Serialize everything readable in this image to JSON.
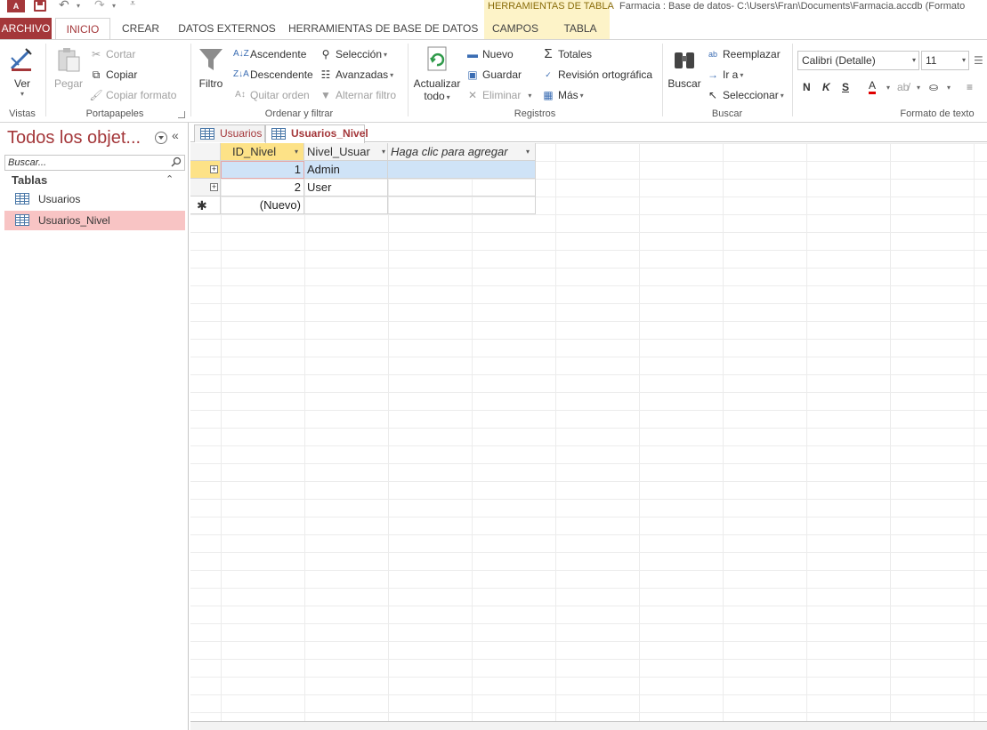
{
  "app": {
    "logo_text": "A",
    "context_group": "HERRAMIENTAS DE TABLA",
    "title": "Farmacia : Base de datos- C:\\Users\\Fran\\Documents\\Farmacia.accdb (Formato"
  },
  "colors": {
    "accent": "#a4373a",
    "context_bg": "#fdf3c8",
    "selected_nav": "#f8c4c4",
    "selected_header": "#fde287",
    "row_highlight": "#cfe3f7"
  },
  "tabs": [
    {
      "label": "ARCHIVO"
    },
    {
      "label": "INICIO"
    },
    {
      "label": "CREAR"
    },
    {
      "label": "DATOS EXTERNOS"
    },
    {
      "label": "HERRAMIENTAS DE BASE DE DATOS"
    },
    {
      "label": "CAMPOS"
    },
    {
      "label": "TABLA"
    }
  ],
  "ribbon": {
    "vistas": {
      "label": "Vistas",
      "ver": "Ver"
    },
    "portapapeles": {
      "label": "Portapapeles",
      "pegar": "Pegar",
      "cortar": "Cortar",
      "copiar": "Copiar",
      "copiar_formato": "Copiar formato"
    },
    "ordenar": {
      "label": "Ordenar y filtrar",
      "filtro": "Filtro",
      "ascendente": "Ascendente",
      "descendente": "Descendente",
      "quitar_orden": "Quitar orden",
      "seleccion": "Selección",
      "avanzadas": "Avanzadas",
      "alternar_filtro": "Alternar filtro"
    },
    "registros": {
      "label": "Registros",
      "actualizar": "Actualizar",
      "todo": "todo",
      "nuevo": "Nuevo",
      "guardar": "Guardar",
      "eliminar": "Eliminar",
      "totales": "Totales",
      "revision": "Revisión ortográfica",
      "mas": "Más"
    },
    "buscar": {
      "label": "Buscar",
      "buscar": "Buscar",
      "reemplazar": "Reemplazar",
      "ir_a": "Ir a",
      "seleccionar": "Seleccionar"
    },
    "formato": {
      "label": "Formato de texto",
      "font": "Calibri (Detalle)",
      "size": "11",
      "bold": "N",
      "italic": "K",
      "underline": "S",
      "font_color": "A"
    }
  },
  "nav": {
    "title": "Todos los objet...",
    "search_placeholder": "Buscar...",
    "group": "Tablas",
    "items": [
      {
        "label": "Usuarios"
      },
      {
        "label": "Usuarios_Nivel"
      }
    ]
  },
  "doc_tabs": [
    {
      "label": "Usuarios"
    },
    {
      "label": "Usuarios_Nivel"
    }
  ],
  "sheet": {
    "columns": [
      {
        "label": "ID_Nivel"
      },
      {
        "label": "Nivel_Usuar"
      },
      {
        "label": "Haga clic para agregar"
      }
    ],
    "rows": [
      {
        "id": "1",
        "nivel": "Admin"
      },
      {
        "id": "2",
        "nivel": "User"
      }
    ],
    "new_row": "(Nuevo)"
  }
}
